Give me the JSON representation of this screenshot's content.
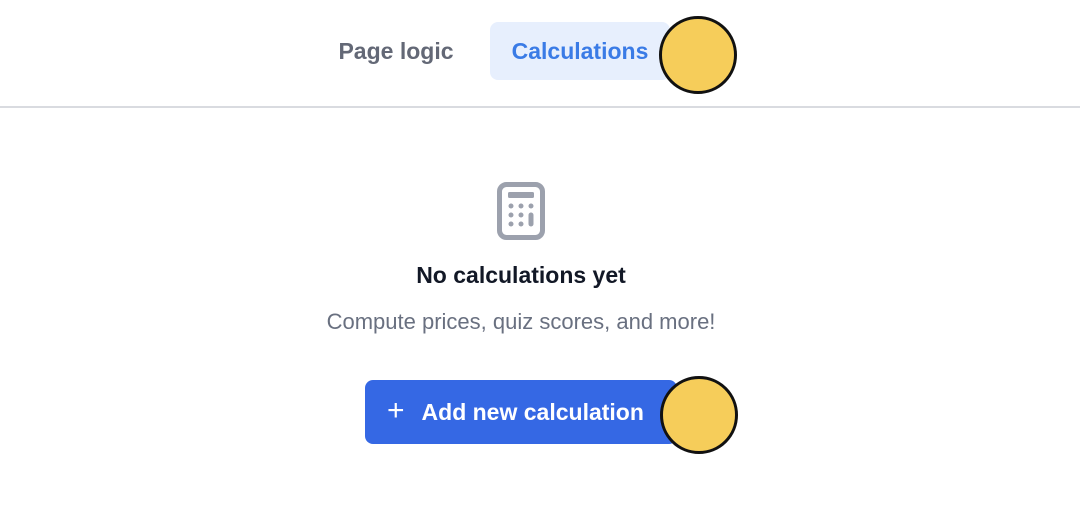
{
  "tabs": [
    {
      "label": "Page logic",
      "active": false
    },
    {
      "label": "Calculations",
      "active": true
    }
  ],
  "empty_state": {
    "icon": "calculator-icon",
    "title": "No calculations yet",
    "subtitle": "Compute prices, quiz scores, and more!",
    "button_label": "Add new calculation",
    "button_icon": "plus-icon"
  },
  "colors": {
    "accent": "#3568e4",
    "active_tab_bg": "#e7effd",
    "active_tab_text": "#3a7be6",
    "marker": "#f6cd5a"
  }
}
